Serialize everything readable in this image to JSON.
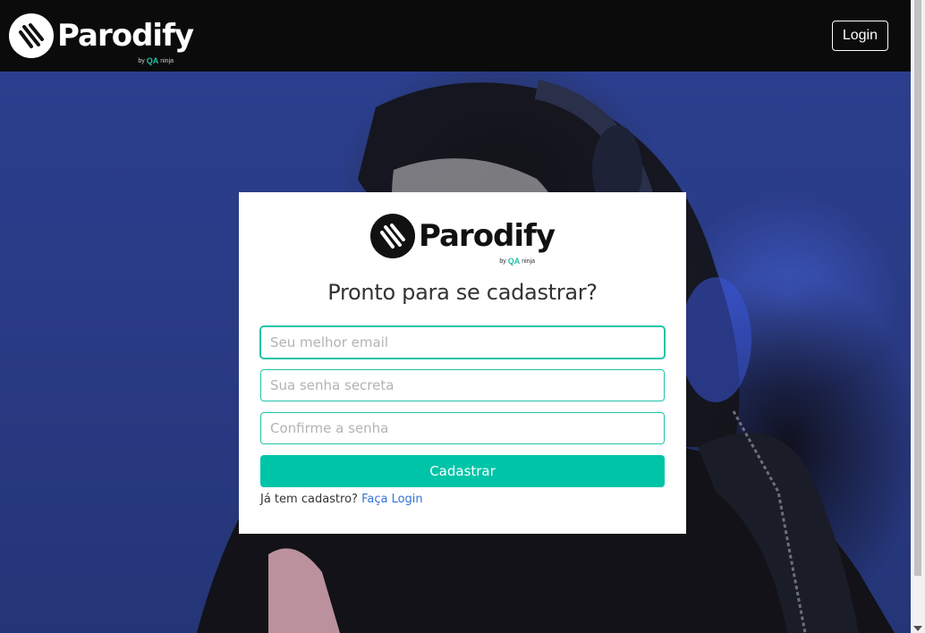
{
  "navbar": {
    "brand": "Parodify",
    "brand_by": "by",
    "brand_by_mark": "QA",
    "brand_by_suffix": "ninja",
    "login_label": "Login"
  },
  "card": {
    "brand": "Parodify",
    "brand_by": "by",
    "brand_by_mark": "QA",
    "brand_by_suffix": "ninja",
    "title": "Pronto para se cadastrar?",
    "email_placeholder": "Seu melhor email",
    "password_placeholder": "Sua senha secreta",
    "confirm_placeholder": "Confirme a senha",
    "submit_label": "Cadastrar",
    "login_prompt": "Já tem cadastro?",
    "login_link": "Faça Login"
  },
  "colors": {
    "accent": "#00c4a7",
    "link": "#3273dc",
    "navbar_bg": "#0b0b0b"
  },
  "icons": {
    "brand_logo": "parodify-sound-wave-icon"
  }
}
